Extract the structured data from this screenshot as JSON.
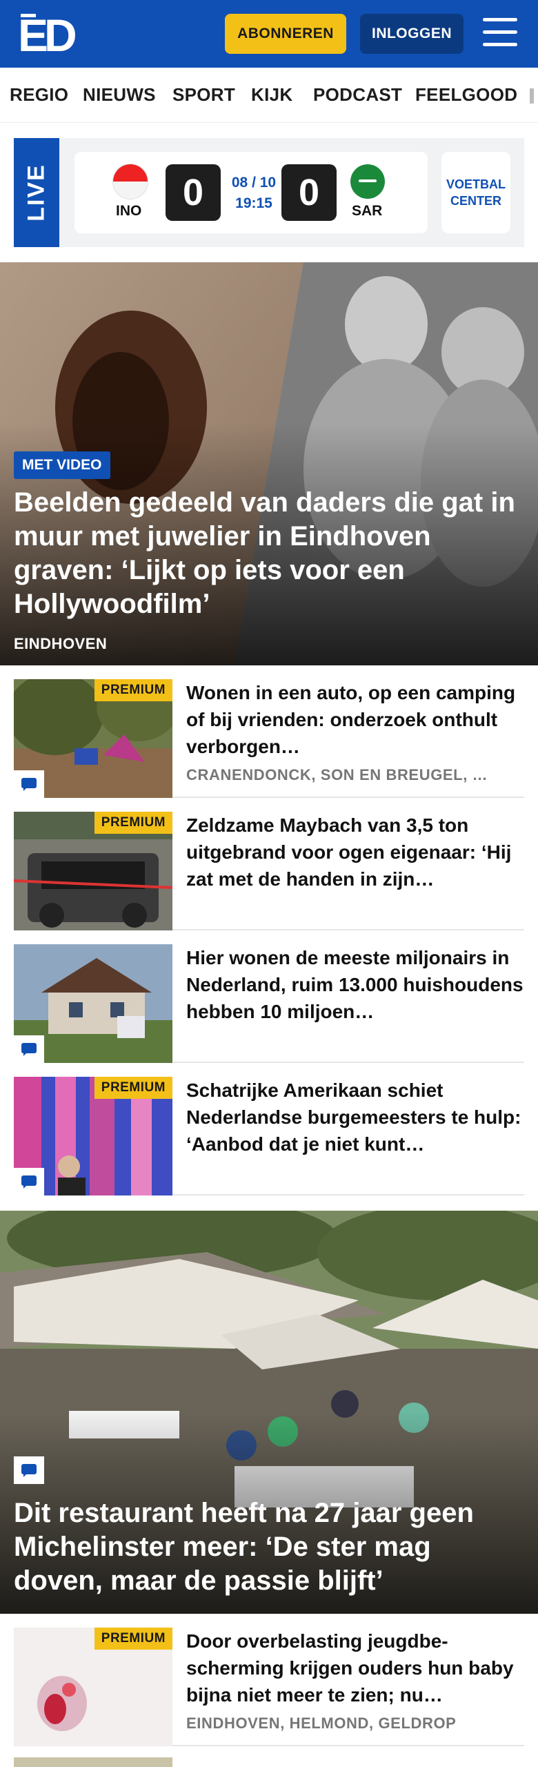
{
  "header": {
    "logo_text": "ED",
    "subscribe_label": "ABONNEREN",
    "login_label": "INLOGGEN",
    "colors": {
      "brand": "#1050b4",
      "accent": "#f3c018"
    }
  },
  "nav": {
    "items": [
      "REGIO",
      "NIEUWS",
      "SPORT",
      "KIJK",
      "PODCAST",
      "FEELGOOD"
    ]
  },
  "live": {
    "tag": "LIVE",
    "home_team": "INO",
    "away_team": "SAR",
    "home_score": "0",
    "away_score": "0",
    "date": "08 / 10",
    "time": "19:15",
    "center_label_1": "VOETBAL",
    "center_label_2": "CENTER"
  },
  "hero": {
    "badge": "MET VIDEO",
    "title": "Beelden gedeeld van daders die gat in muur met juwelier in Eindhoven graven: ‘Lijkt op iets voor een Hollywoodfilm’",
    "location": "EINDHOVEN"
  },
  "articles": [
    {
      "premium": "PREMIUM",
      "title": "Wonen in een auto, op een camping of bij vrienden: onderzoek onthult verborgen…",
      "location": "CRANENDONCK, SON EN BREUGEL, …",
      "comments": true
    },
    {
      "premium": "PREMIUM",
      "title": "Zeldzame Maybach van 3,5 ton uitgebrand voor ogen eigenaar: ‘Hij zat met de handen in zijn…",
      "location": "",
      "comments": false
    },
    {
      "premium": "",
      "title": "Hier wonen de meeste miljonairs in Nederland, ruim 13.000 huishoudens hebben 10 miljoen…",
      "location": "",
      "comments": true
    },
    {
      "premium": "PREMIUM",
      "title": "Schatrijke Amerikaan schiet Nederlandse burgemeesters te hulp: ‘Aanbod dat je niet kunt…",
      "location": "",
      "comments": true
    }
  ],
  "feature": {
    "title": "Dit restaurant heeft na 27 jaar geen Michelinster meer: ‘De ster mag doven, maar de passie blijft’"
  },
  "article_bottom": {
    "premium": "PREMIUM",
    "title": "Door overbelasting jeugdbe- scherming krijgen ouders hun baby bijna niet meer te zien; nu…",
    "location": "EINDHOVEN, HELMOND, GELDROP"
  }
}
